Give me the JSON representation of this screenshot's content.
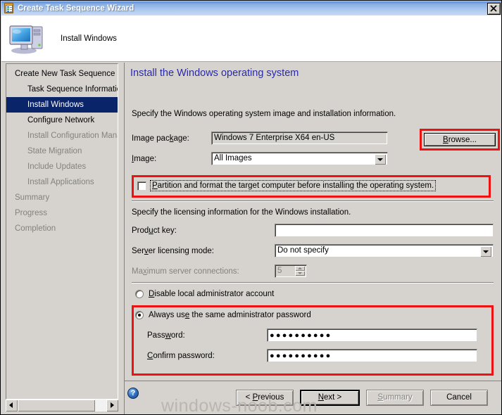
{
  "window": {
    "title": "Create Task Sequence Wizard",
    "icon": "clipboard-checklist-icon",
    "close_label": "Close"
  },
  "header": {
    "title": "Install Windows",
    "icon": "computer-icon"
  },
  "sidebar": {
    "items": [
      {
        "label": "Create New Task Sequence",
        "indent": false,
        "state": "normal"
      },
      {
        "label": "Task Sequence Information",
        "indent": true,
        "state": "normal"
      },
      {
        "label": "Install Windows",
        "indent": true,
        "state": "selected"
      },
      {
        "label": "Configure Network",
        "indent": true,
        "state": "normal"
      },
      {
        "label": "Install Configuration Manag",
        "indent": true,
        "state": "dim"
      },
      {
        "label": "State Migration",
        "indent": true,
        "state": "dim"
      },
      {
        "label": "Include Updates",
        "indent": true,
        "state": "dim"
      },
      {
        "label": "Install Applications",
        "indent": true,
        "state": "dim"
      },
      {
        "label": "Summary",
        "indent": false,
        "state": "dim"
      },
      {
        "label": "Progress",
        "indent": false,
        "state": "dim"
      },
      {
        "label": "Completion",
        "indent": false,
        "state": "dim"
      }
    ],
    "scrollbar": {
      "left_arrow": "◄",
      "right_arrow": "►"
    }
  },
  "content": {
    "page_title": "Install the Windows operating system",
    "intro_image": "Specify the Windows operating system image and installation information.",
    "intro_license": "Specify the licensing information for the Windows installation.",
    "image_package": {
      "label": "Image package:",
      "label_pre": "Image pac",
      "label_accel": "k",
      "label_post": "age:",
      "value": "Windows 7 Enterprise X64 en-US"
    },
    "browse_button": {
      "pre": "B",
      "accel": "B",
      "label": "Browse..."
    },
    "image": {
      "label": "Image:",
      "value": "All Images",
      "options": [
        "All Images"
      ]
    },
    "partition_checkbox": {
      "label": "Partition and format the target computer before installing the operating system.",
      "checked": false
    },
    "product_key": {
      "label": "Product key:",
      "value": "",
      "placeholder": ""
    },
    "server_licensing_mode": {
      "label": "Server licensing mode:",
      "value": "Do not specify",
      "options": [
        "Do not specify"
      ]
    },
    "max_server_connections": {
      "label": "Maximum server connections:",
      "value": "5",
      "disabled": true
    },
    "radio_disable_admin": {
      "label": "Disable local administrator account",
      "checked": false
    },
    "radio_same_password": {
      "label": "Always use the same administrator password",
      "checked": true
    },
    "password": {
      "label": "Password:",
      "value": "●●●●●●●●●●"
    },
    "confirm_password": {
      "label": "Confirm password:",
      "value": "●●●●●●●●●●"
    }
  },
  "footer": {
    "help_icon": "help-question-icon",
    "previous": "< Previous",
    "next": "Next >",
    "summary": "Summary",
    "cancel": "Cancel"
  },
  "watermark": "windows-noob.com",
  "colors": {
    "accent_title": "#2a2aa8",
    "selection": "#0a246a",
    "annotation_red": "#ee1111",
    "face": "#d6d3ce",
    "titlebar_blue": "#5b8ad6"
  }
}
